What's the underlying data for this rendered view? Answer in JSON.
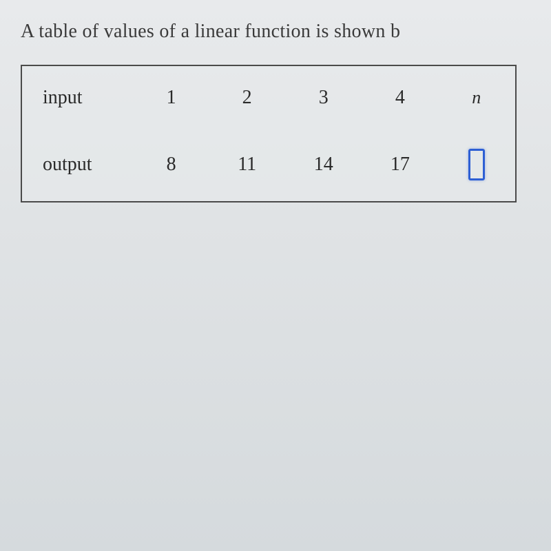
{
  "question": "A table of values of a linear function is shown b",
  "chart_data": {
    "type": "table",
    "rows": [
      {
        "label": "input",
        "values": [
          "1",
          "2",
          "3",
          "4",
          "n"
        ]
      },
      {
        "label": "output",
        "values": [
          "8",
          "11",
          "14",
          "17",
          ""
        ]
      }
    ]
  }
}
